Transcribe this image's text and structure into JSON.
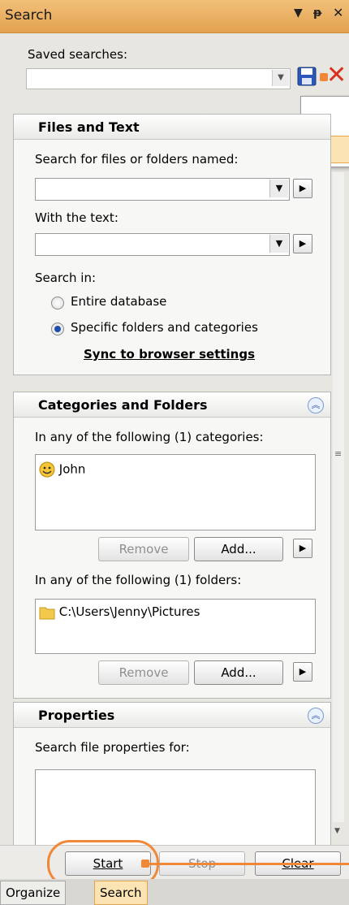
{
  "titlebar": {
    "title": "Search",
    "icons": [
      "dropdown-icon",
      "pin-icon",
      "close-icon"
    ]
  },
  "saved": {
    "label": "Saved searches:",
    "value": ""
  },
  "files_text": {
    "title": "Files and Text",
    "named_label": "Search for files or folders named:",
    "named_value": "",
    "text_label": "With the text:",
    "text_value": "",
    "search_in_label": "Search in:",
    "options": [
      "Entire database",
      "Specific folders and categories"
    ],
    "selected_option": "Specific folders and categories",
    "sync_link": "Sync to browser settings"
  },
  "cat_folders": {
    "title": "Categories and Folders",
    "cat_label": "In any of the following (1) categories:",
    "categories": [
      "John"
    ],
    "remove_label": "Remove",
    "add_label": "Add...",
    "folders_label": "In any of the following (1) folders:",
    "folders": [
      "C:\\Users\\Jenny\\Pictures"
    ]
  },
  "properties": {
    "title": "Properties",
    "label": "Search file properties for:"
  },
  "actions": {
    "start": "Start",
    "stop": "Stop",
    "clear": "Clear"
  },
  "tabs": {
    "organize": "Organize",
    "search": "Search",
    "active": "Search"
  },
  "colors": {
    "accent": "#f0883a",
    "titlebar": "#e8ae5e",
    "radio_on": "#1e4fb0"
  }
}
